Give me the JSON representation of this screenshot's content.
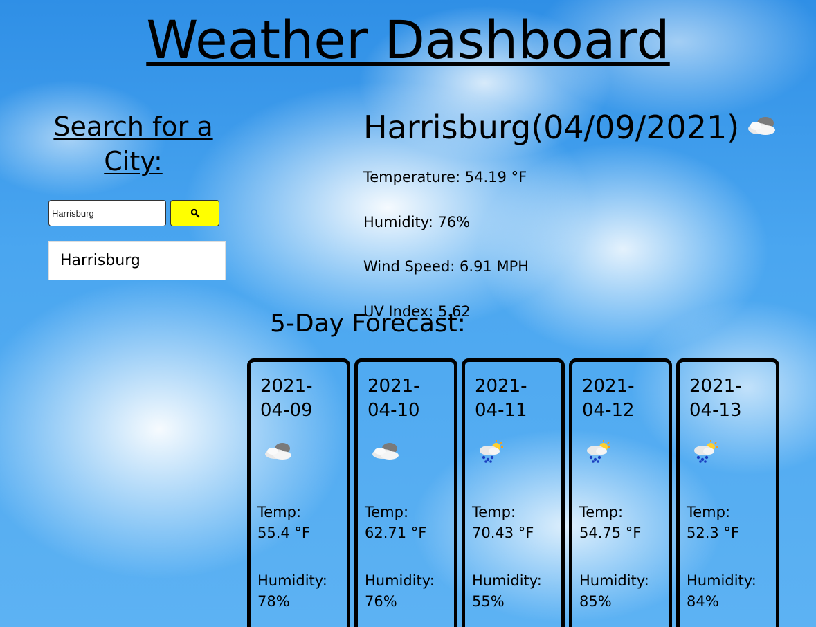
{
  "app": {
    "title": "Weather Dashboard"
  },
  "search": {
    "heading": "Search for a City:",
    "input_value": "Harrisburg",
    "button_icon": "search-icon",
    "history": [
      "Harrisburg"
    ]
  },
  "current": {
    "city": "Harrisburg",
    "date": "(04/09/2021)",
    "icon": "broken-clouds-icon",
    "temperature": "Temperature: 54.19 °F",
    "humidity": "Humidity: 76%",
    "wind_speed": "Wind Speed: 6.91 MPH",
    "uv_index": "UV Index: 5.62"
  },
  "forecast": {
    "heading": "5-Day Forecast:",
    "temp_label": "Temp:",
    "humidity_label": "Humidity:",
    "days": [
      {
        "date": "2021-04-09",
        "icon": "broken-clouds-icon",
        "temp": "55.4 °F",
        "humidity": "78%"
      },
      {
        "date": "2021-04-10",
        "icon": "broken-clouds-icon",
        "temp": "62.71 °F",
        "humidity": "76%"
      },
      {
        "date": "2021-04-11",
        "icon": "rain-sun-icon",
        "temp": "70.43 °F",
        "humidity": "55%"
      },
      {
        "date": "2021-04-12",
        "icon": "rain-sun-icon",
        "temp": "54.75 °F",
        "humidity": "85%"
      },
      {
        "date": "2021-04-13",
        "icon": "rain-sun-icon",
        "temp": "52.3 °F",
        "humidity": "84%"
      }
    ]
  },
  "colors": {
    "search_button": "#ffff00",
    "sky": "#4aa6f0"
  }
}
